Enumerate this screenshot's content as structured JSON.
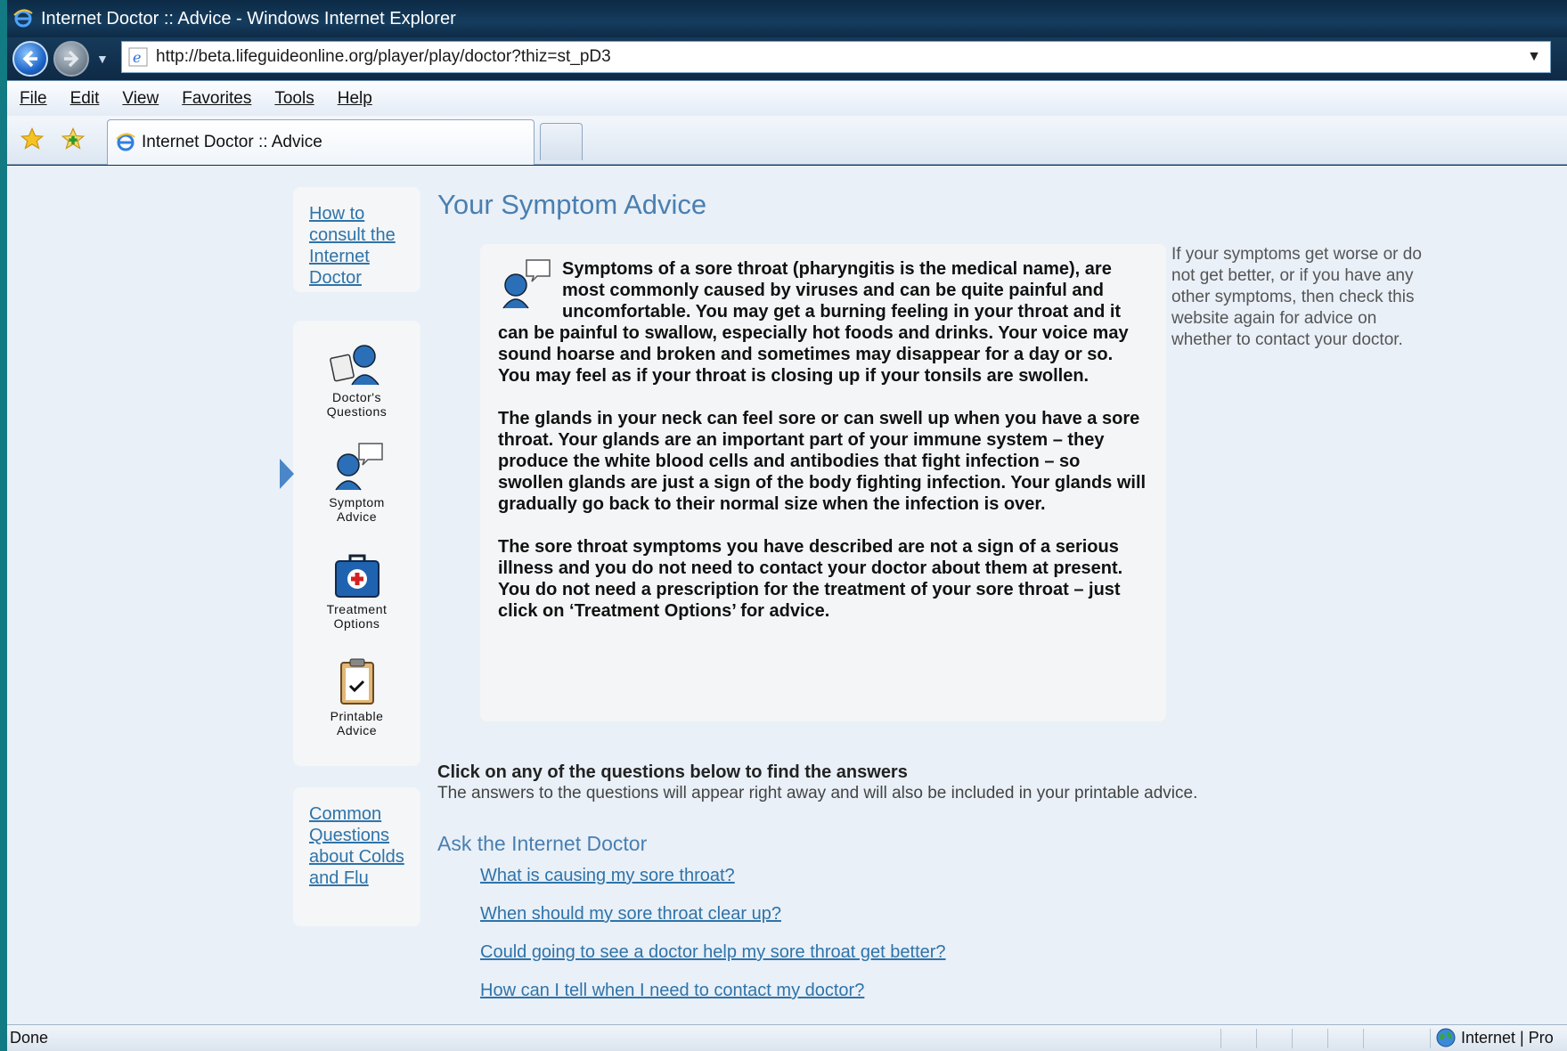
{
  "window": {
    "title": "Internet Doctor :: Advice - Windows Internet Explorer"
  },
  "address": {
    "url": "http://beta.lifeguideonline.org/player/play/doctor?thiz=st_pD3"
  },
  "menu": [
    "File",
    "Edit",
    "View",
    "Favorites",
    "Tools",
    "Help"
  ],
  "tab": {
    "title": "Internet Doctor :: Advice"
  },
  "sidebar": {
    "top_link": "How to consult the Internet Doctor",
    "nav": [
      {
        "label1": "Doctor's",
        "label2": "Questions"
      },
      {
        "label1": "Symptom",
        "label2": "Advice"
      },
      {
        "label1": "Treatment",
        "label2": "Options"
      },
      {
        "label1": "Printable",
        "label2": "Advice"
      }
    ],
    "bottom_link": "Common Questions about Colds and Flu"
  },
  "main": {
    "title": "Your Symptom Advice",
    "paragraphs": [
      "Symptoms of a sore throat (pharyngitis is the medical name), are most commonly caused by viruses and can be quite painful and uncomfortable. You may get a burning feeling in your throat and it can be painful to swallow, especially hot foods and drinks. Your voice may sound hoarse and broken and sometimes may disappear for a day or so. You may feel as if your throat is closing up if your tonsils are swollen.",
      "The glands in your neck can feel sore or can swell up when you have a sore throat. Your glands are an important part of your immune system – they produce the white blood cells and antibodies that fight infection – so swollen glands are just a sign of the body fighting infection. Your glands will gradually go back to their normal size when the infection is over.",
      "The sore throat symptoms you have described are not a sign of a serious illness and you do not need to contact your doctor about them at present. You do not need a prescription for the treatment of your sore throat – just click on ‘Treatment Options’ for advice."
    ],
    "side_note": "If your symptoms get worse or do not get better, or if you have any other symptoms, then check this website again for advice on whether to contact your doctor.",
    "questions_heading": "Click on any of the questions below to find the answers",
    "questions_sub": "The answers to the questions will appear right away and will also be included in your printable advice.",
    "ask_title": "Ask the Internet Doctor",
    "questions": [
      "What is causing my sore throat?",
      "When should my sore throat clear up?",
      "Could going to see a doctor help my sore throat get better?",
      "How can I tell when I need to contact my doctor?"
    ]
  },
  "status": {
    "left": "Done",
    "zone": "Internet | Pro"
  },
  "colors": {
    "accent": "#4a7fb0",
    "link": "#2f73a8",
    "content_bg": "#e9f0f8"
  }
}
